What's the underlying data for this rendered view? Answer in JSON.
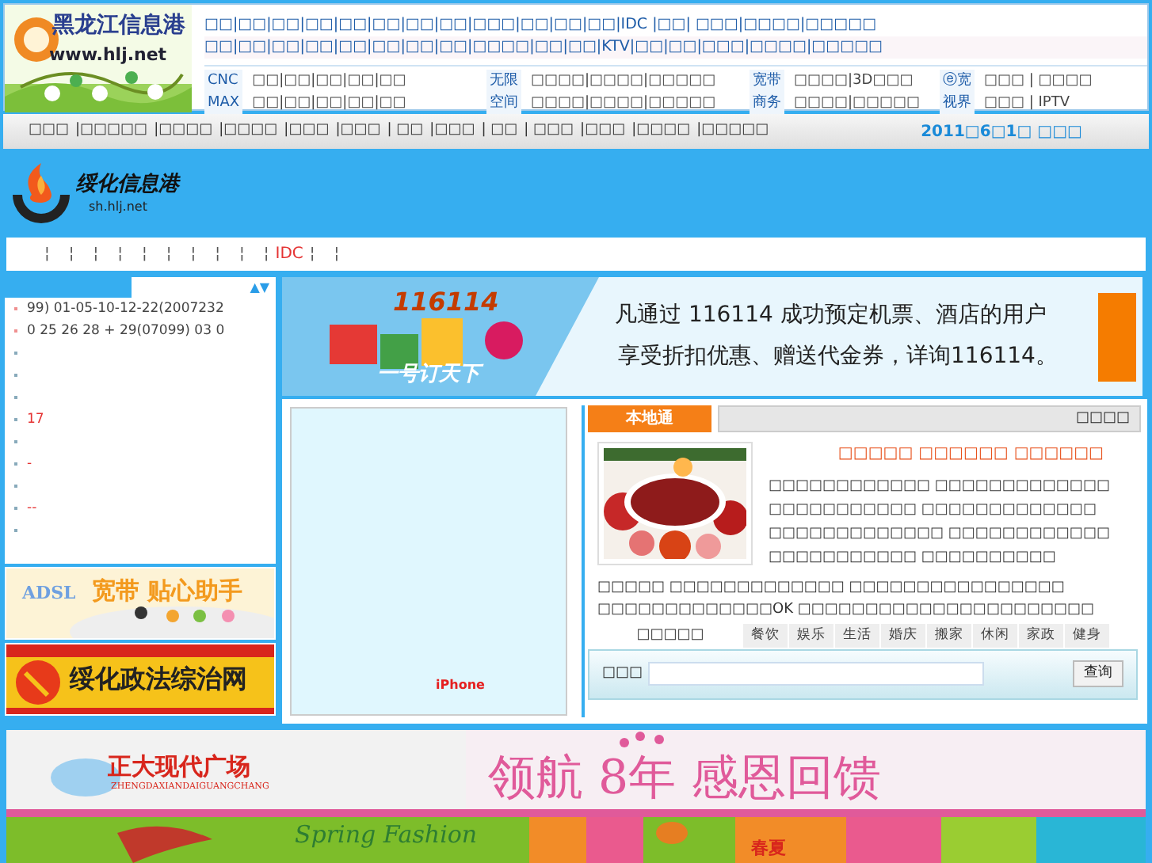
{
  "header": {
    "logo_title": "黑龙江信息港",
    "logo_url": "www.hlj.net",
    "link_rows": [
      "□□|□□|□□|□□|□□|□□|□□|□□|□□□|□□|□□|□□|IDC |□□| □□□|□□□□|□□□□□",
      "□□|□□|□□|□□|□□|□□|□□|□□|□□□□|□□|□□|KTV|□□|□□|□□□|□□□□|□□□□□"
    ],
    "services": [
      {
        "labels": [
          "CNC",
          "MAX"
        ],
        "lines": [
          "□□|□□|□□|□□|□□",
          "□□|□□|□□|□□|□□"
        ]
      },
      {
        "labels": [
          "无限",
          "空间"
        ],
        "lines": [
          "□□□□|□□□□|□□□□□",
          "□□□□|□□□□|□□□□□"
        ]
      },
      {
        "labels": [
          "宽带",
          "商务"
        ],
        "lines": [
          "□□□□|3D□□□",
          "□□□□|□□□□□"
        ]
      },
      {
        "labels": [
          "ⓔ宽",
          "视界"
        ],
        "lines": [
          "□□□ | □□□□",
          "□□□ | IPTV"
        ]
      }
    ]
  },
  "nav": {
    "items": [
      "□□□",
      "|□□□□□",
      "|□□□□",
      "|□□□□",
      "|□□□",
      "|□□□",
      "| □□",
      "|□□□",
      "| □□",
      "| □□□",
      "|□□□",
      "|□□□□",
      "|□□□□□"
    ],
    "date": "2011□6□1□ □□□"
  },
  "site_logo": {
    "title": "绥化信息港",
    "url": "sh.hlj.net"
  },
  "subnav": [
    {
      "text": "¦",
      "kind": "sep"
    },
    {
      "text": "¦",
      "kind": "sep"
    },
    {
      "text": "¦",
      "kind": "sep"
    },
    {
      "text": "¦",
      "kind": "sep"
    },
    {
      "text": "¦",
      "kind": "sep"
    },
    {
      "text": "¦",
      "kind": "sep"
    },
    {
      "text": "¦",
      "kind": "sep"
    },
    {
      "text": "¦",
      "kind": "sep"
    },
    {
      "text": "¦",
      "kind": "sep"
    },
    {
      "text": "¦",
      "kind": "sep"
    },
    {
      "text": "IDC",
      "kind": "link"
    },
    {
      "text": "¦",
      "kind": "sep"
    },
    {
      "text": "¦",
      "kind": "sep"
    }
  ],
  "lottery": {
    "arrows": "▲▼",
    "rows": [
      {
        "text": "99) 01-05-10-12-22(2007232",
        "color": "#444444"
      },
      {
        "text": "0 25 26 28 + 29(07099) 03 0",
        "color": "#444444"
      },
      {},
      {},
      {},
      {
        "text": "17",
        "color": "#e53333"
      },
      {},
      {
        "text": "-",
        "color": "#e53333"
      },
      {},
      {
        "text": "--",
        "color": "#e53333"
      },
      {}
    ]
  },
  "left_banners": [
    {
      "kind": "adsl",
      "words": [
        "ADSL",
        "宽带 贴心助手"
      ]
    },
    {
      "kind": "law",
      "words": [
        "绥化政法综治网"
      ]
    }
  ],
  "promo_banner": {
    "slogan": "一号订天下",
    "number": "116114",
    "line1": "凡通过 116114 成功预定机票、酒店的用户",
    "line2": "享受折扣优惠、赠送代金券，详询116114。"
  },
  "phone_box": {
    "caption": "iPhone"
  },
  "local": {
    "tabs": [
      {
        "label": "本地通",
        "selected": true
      },
      {
        "label": "□□□□",
        "selected": false
      }
    ],
    "headline": "□□□□□ □□□□□□ □□□□□□",
    "side_lines": [
      "□□□□□□□□□□□□ □□□□□□□□□□□□□",
      "□□□□□□□□□□□ □□□□□□□□□□□□□",
      "□□□□□□□□□□□□□ □□□□□□□□□□□□",
      "□□□□□□□□□□□ □□□□□□□□□□"
    ],
    "lines": [
      "□□□□□ □□□□□□□□□□□□□ □□□□□□□□□□□□□□□□",
      "□□□□□□□□□□□□□OK □□□□□□□□□□□□□□□□□□□□□□"
    ],
    "category_label": "□□□□□",
    "categories": [
      "餐饮",
      "娱乐",
      "生活",
      "婚庆",
      "搬家",
      "休闲",
      "家政",
      "健身"
    ],
    "search_label": "□□□",
    "search_button": "查询"
  },
  "bottom_banners": {
    "brand": "正大现代广场",
    "brand_pinyin": "ZHENGDAXIANDAIGUANGCHANG",
    "slogan": "领航 8年 感恩回馈",
    "fashion": "Spring Fashion",
    "season": "春夏"
  }
}
